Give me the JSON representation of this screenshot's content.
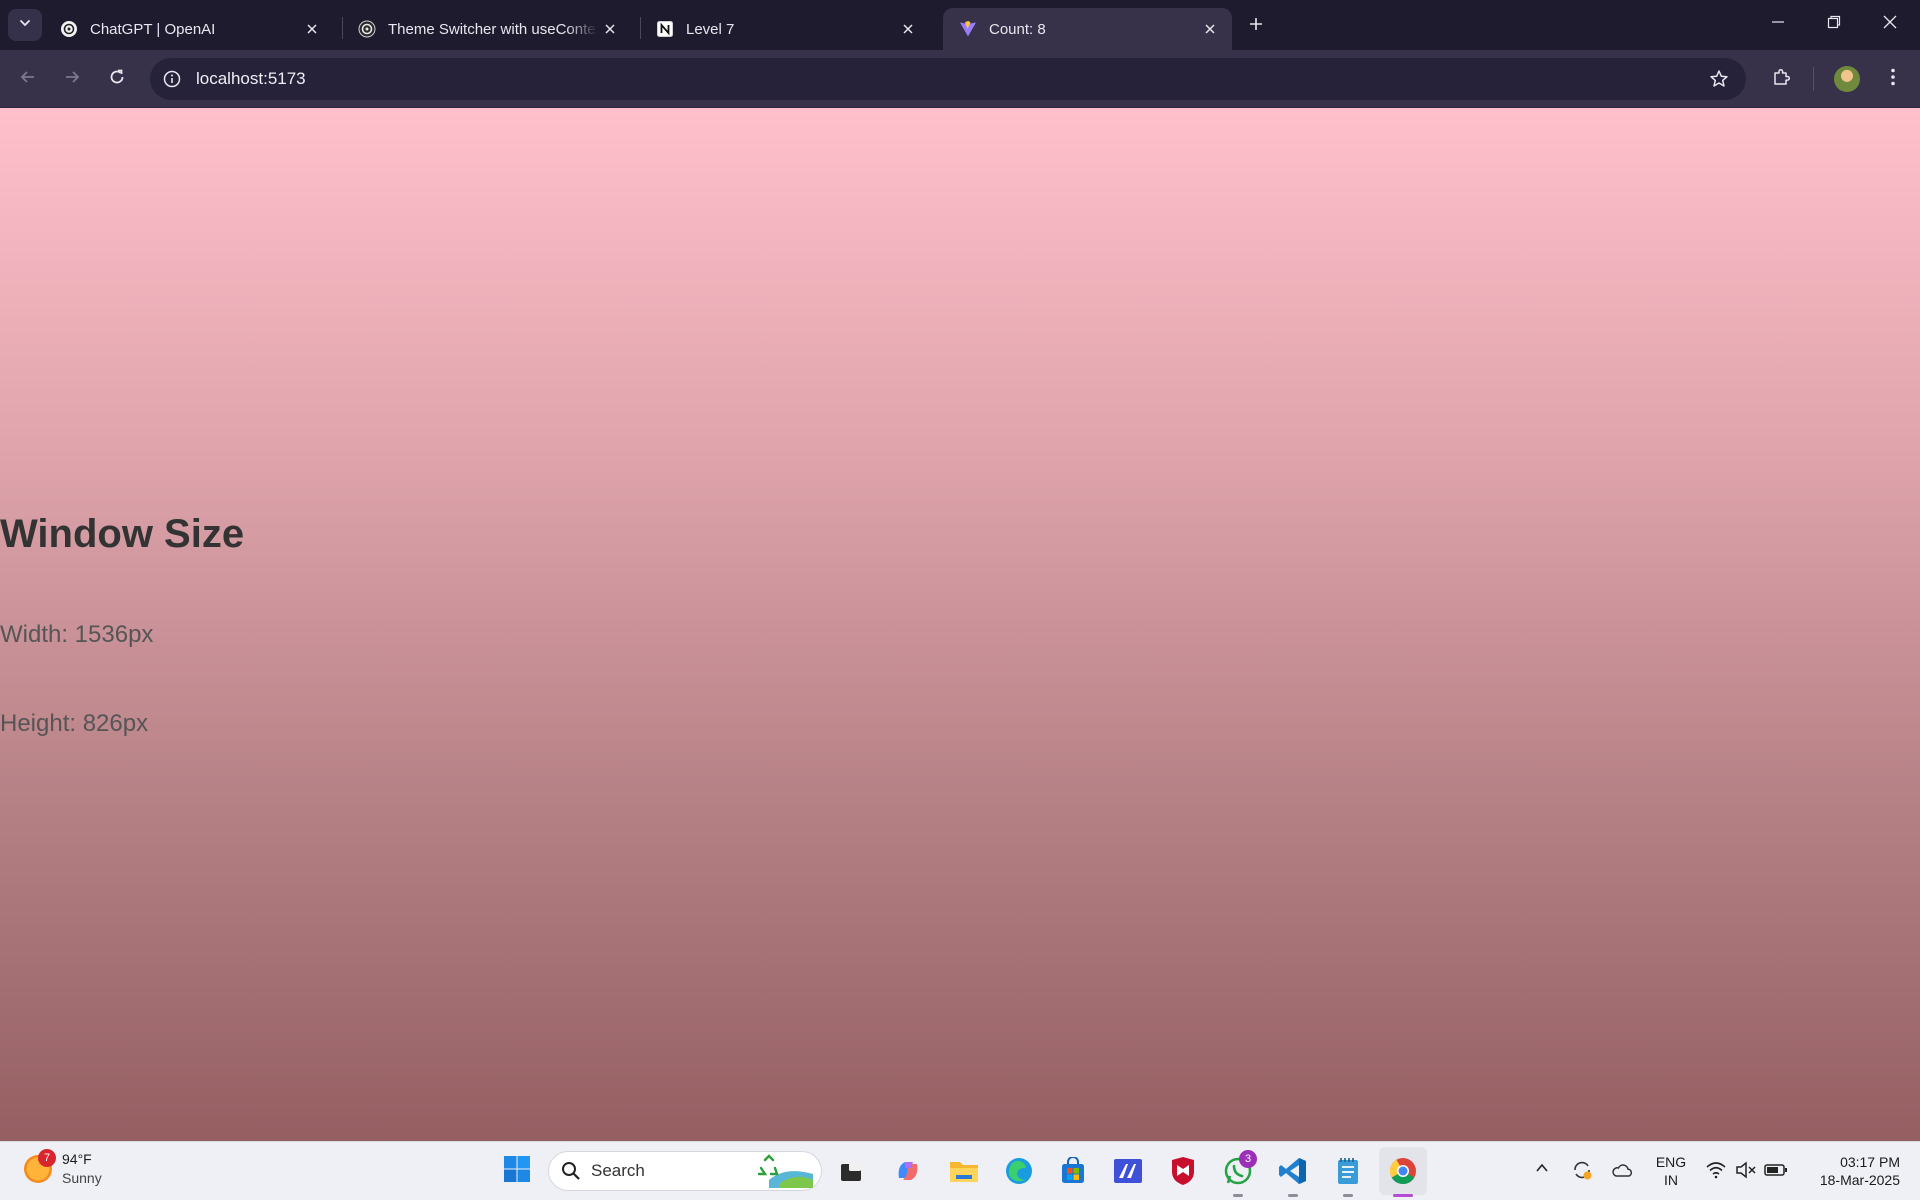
{
  "browser": {
    "tabs": [
      {
        "title": "ChatGPT | OpenAI",
        "icon": "openai-icon",
        "active": false
      },
      {
        "title": "Theme Switcher with useContext",
        "icon": "openai-icon",
        "active": false
      },
      {
        "title": "Level 7",
        "icon": "notion-icon",
        "active": false
      },
      {
        "title": "Count: 8",
        "icon": "vite-icon",
        "active": true
      }
    ],
    "address_bar": {
      "url": "localhost:5173"
    }
  },
  "page": {
    "heading": "Window Size",
    "width_text": "Width: 1536px",
    "height_text": "Height: 826px",
    "background_gradient": [
      "#ffc0cb",
      "#955f62"
    ],
    "heading_color": "#333333",
    "text_color": "#555555"
  },
  "taskbar": {
    "weather": {
      "temperature": "94°F",
      "condition": "Sunny",
      "badge": "7"
    },
    "search_placeholder": "Search",
    "pinned_apps": [
      "file-explorer-dark-icon",
      "copilot-icon",
      "folder-icon",
      "edge-icon",
      "microsoft-store-icon",
      "app-icon",
      "mcafee-icon",
      "whatsapp-icon",
      "vscode-icon",
      "notepad-icon",
      "chrome-icon"
    ],
    "whatsapp_badge": "3",
    "language": {
      "line1": "ENG",
      "line2": "IN"
    },
    "clock": {
      "time": "03:17 PM",
      "date": "18-Mar-2025"
    }
  }
}
